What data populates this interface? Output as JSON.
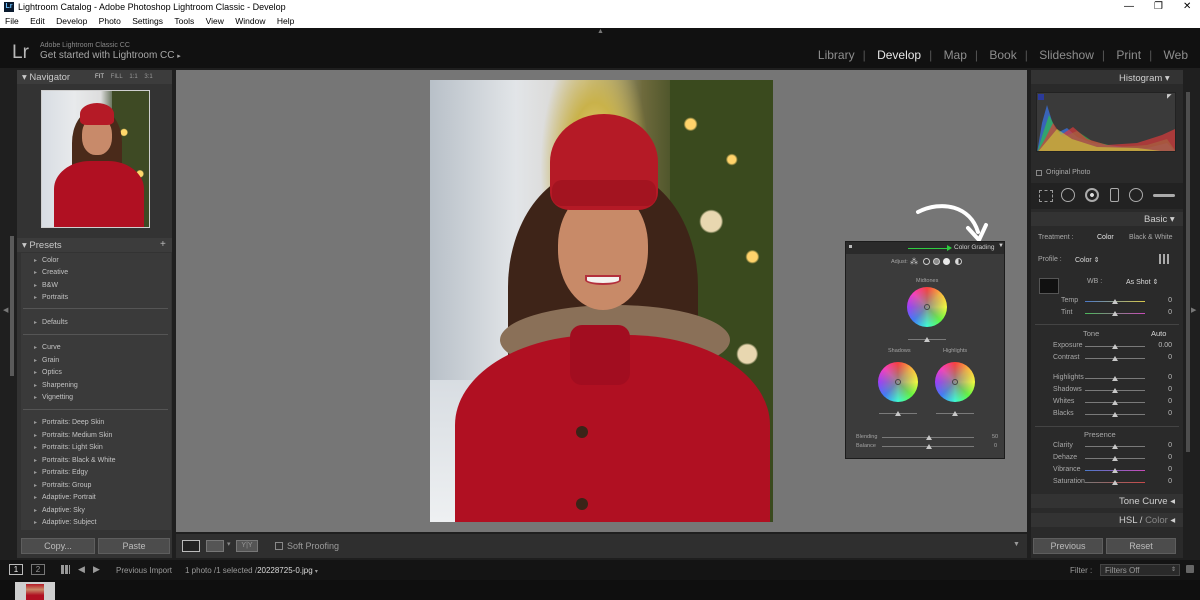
{
  "window": {
    "title": "Lightroom Catalog - Adobe Photoshop Lightroom Classic - Develop",
    "app_icon": "Lr",
    "controls": [
      "minimize",
      "maximize",
      "close"
    ]
  },
  "menu": [
    "File",
    "Edit",
    "Develop",
    "Photo",
    "Settings",
    "Tools",
    "View",
    "Window",
    "Help"
  ],
  "header": {
    "logo": "Lr",
    "brand_small": "Adobe Lightroom Classic CC",
    "brand_large": "Get started with Lightroom CC",
    "modules": [
      "Library",
      "Develop",
      "Map",
      "Book",
      "Slideshow",
      "Print",
      "Web"
    ],
    "active_module": "Develop"
  },
  "navigator": {
    "title": "Navigator",
    "zoom_options": [
      "FIT",
      "FILL",
      "1:1",
      "3:1"
    ]
  },
  "presets": {
    "title": "Presets",
    "groups": [
      [
        "Color",
        "Creative",
        "B&W",
        "Portraits"
      ],
      [
        "Defaults"
      ],
      [
        "Curve",
        "Grain",
        "Optics",
        "Sharpening",
        "Vignetting"
      ],
      [
        "Portraits: Deep Skin",
        "Portraits: Medium Skin",
        "Portraits: Light Skin",
        "Portraits: Black & White",
        "Portraits: Edgy",
        "Portraits: Group",
        "Adaptive: Portrait",
        "Adaptive: Sky",
        "Adaptive: Subject"
      ]
    ],
    "copy_label": "Copy...",
    "paste_label": "Paste"
  },
  "toolbar": {
    "soft_proofing": "Soft Proofing"
  },
  "filmbar": {
    "page1": "1",
    "page2": "2",
    "source": "Previous Import",
    "status": "1 photo /1 selected /",
    "filename": "20228725-0.jpg",
    "filter_label": "Filter :",
    "filter_value": "Filters Off"
  },
  "right": {
    "histogram_title": "Histogram",
    "original_photo": "Original Photo",
    "basic_title": "Basic",
    "treatment_label": "Treatment :",
    "treatment_color": "Color",
    "treatment_bw": "Black & White",
    "profile_label": "Profile :",
    "profile_value": "Color",
    "wb_label": "WB :",
    "wb_value": "As Shot",
    "temp_label": "Temp",
    "tint_label": "Tint",
    "tone_label": "Tone",
    "auto_label": "Auto",
    "tone_sliders": [
      {
        "label": "Exposure",
        "value": "0.00"
      },
      {
        "label": "Contrast",
        "value": "0"
      },
      {
        "label": "Highlights",
        "value": "0"
      },
      {
        "label": "Shadows",
        "value": "0"
      },
      {
        "label": "Whites",
        "value": "0"
      },
      {
        "label": "Blacks",
        "value": "0"
      }
    ],
    "presence_label": "Presence",
    "presence_sliders": [
      {
        "label": "Clarity",
        "value": "0"
      },
      {
        "label": "Dehaze",
        "value": "0"
      },
      {
        "label": "Vibrance",
        "value": "0"
      },
      {
        "label": "Saturation",
        "value": "0"
      }
    ],
    "temp_value": "0",
    "tint_value": "0",
    "tone_curve_title": "Tone Curve",
    "hsl_title": "HSL",
    "hsl_color": "Color",
    "previous_label": "Previous",
    "reset_label": "Reset"
  },
  "color_grading": {
    "title": "Color Grading",
    "adjust_label": "Adjust:",
    "midtones": "Midtones",
    "shadows": "Shadows",
    "highlights": "Highlights",
    "blending_label": "Blending",
    "blending_value": "50",
    "balance_label": "Balance",
    "balance_value": "0"
  },
  "colors": {
    "accent_green": "#2ecc40",
    "panel_bg": "#333333",
    "canvas_bg": "#767676",
    "coat_red": "#b01022"
  }
}
